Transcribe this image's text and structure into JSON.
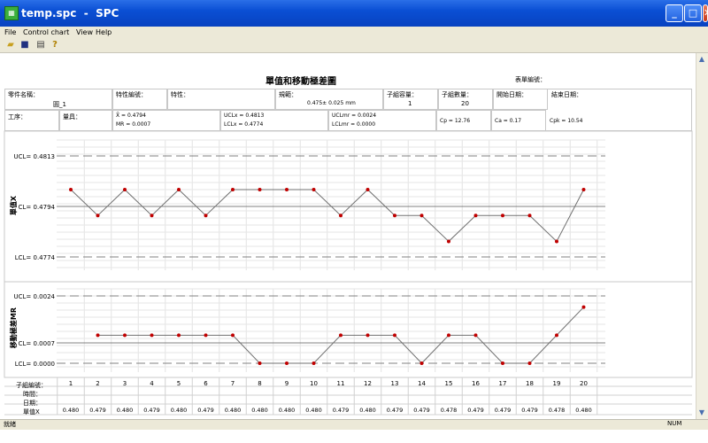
{
  "window": {
    "title": "temp.spc  -  SPC",
    "app_icon": "spc-app-icon",
    "minimize": "_",
    "maximize": "□",
    "close": "✕"
  },
  "menu": [
    "File",
    "Control chart",
    "View",
    "Help"
  ],
  "toolbar": [
    "open-folder-icon",
    "save-icon",
    "print-icon",
    "help-icon"
  ],
  "report": {
    "title": "單值和移動極差圖",
    "table_no_label": "表單編號：",
    "part_name_label": "零件名稱：",
    "part_name_value": "圓_1",
    "char_no_label": "特性編號：",
    "char_label": "特性：",
    "spec_label": "規範：",
    "spec_value": "0.475± 0.025 mm",
    "subgroup_size_label": "子組容量：",
    "subgroup_size_value": "1",
    "subgroup_count_label": "子組數量：",
    "subgroup_count_value": "20",
    "start_date_label": "開始日期：",
    "end_date_label": "結束日期：",
    "process_label": "工序：",
    "gauge_label": "量具：",
    "xbar": "X̄ =  0.4794",
    "mrbar": "MR =  0.0007",
    "uclx": "UCLx =  0.4813",
    "lclx": "LCLx =  0.4774",
    "uclmr": "UCLmr =  0.0024",
    "lclmr": "LCLmr =  0.0000",
    "cp": "Cp = 12.76",
    "ca": "Ca = 0.17",
    "cpk": "Cpk = 10.54"
  },
  "bottom_labels": {
    "subgroup_no": "子組編號：",
    "time": "時間：",
    "date": "日期：",
    "value": "單值X"
  },
  "status": {
    "left": "就緒",
    "right": "NUM"
  },
  "chart_data": [
    {
      "type": "line",
      "ylabel": "單值X",
      "x": [
        1,
        2,
        3,
        4,
        5,
        6,
        7,
        8,
        9,
        10,
        11,
        12,
        13,
        14,
        15,
        16,
        17,
        18,
        19,
        20
      ],
      "values": [
        0.48,
        0.479,
        0.48,
        0.479,
        0.48,
        0.479,
        0.48,
        0.48,
        0.48,
        0.48,
        0.479,
        0.48,
        0.479,
        0.479,
        0.478,
        0.479,
        0.479,
        0.479,
        0.478,
        0.48
      ],
      "value_labels": [
        "0.480",
        "0.479",
        "0.480",
        "0.479",
        "0.480",
        "0.479",
        "0.480",
        "0.480",
        "0.480",
        "0.480",
        "0.479",
        "0.480",
        "0.479",
        "0.479",
        "0.478",
        "0.479",
        "0.479",
        "0.479",
        "0.478",
        "0.480"
      ],
      "ucl": 0.4813,
      "cl": 0.4794,
      "lcl": 0.4774,
      "ucl_label": "UCL= 0.4813",
      "cl_label": "CL= 0.4794",
      "lcl_label": "LCL= 0.4774",
      "grid": true,
      "line_color": "#707070",
      "point_color": "#c00000"
    },
    {
      "type": "line",
      "ylabel": "移動極差MR",
      "x": [
        2,
        3,
        4,
        5,
        6,
        7,
        8,
        9,
        10,
        11,
        12,
        13,
        14,
        15,
        16,
        17,
        18,
        19,
        20
      ],
      "values": [
        0.001,
        0.001,
        0.001,
        0.001,
        0.001,
        0.001,
        0.0,
        0.0,
        0.0,
        0.001,
        0.001,
        0.001,
        0.0,
        0.001,
        0.001,
        0.0,
        0.0,
        0.001,
        0.002
      ],
      "ucl": 0.0024,
      "cl": 0.0007,
      "lcl": 0.0,
      "ucl_label": "UCL= 0.0024",
      "cl_label": "CL= 0.0007",
      "lcl_label": "LCL= 0.0000",
      "grid": true,
      "line_color": "#707070",
      "point_color": "#c00000"
    }
  ]
}
